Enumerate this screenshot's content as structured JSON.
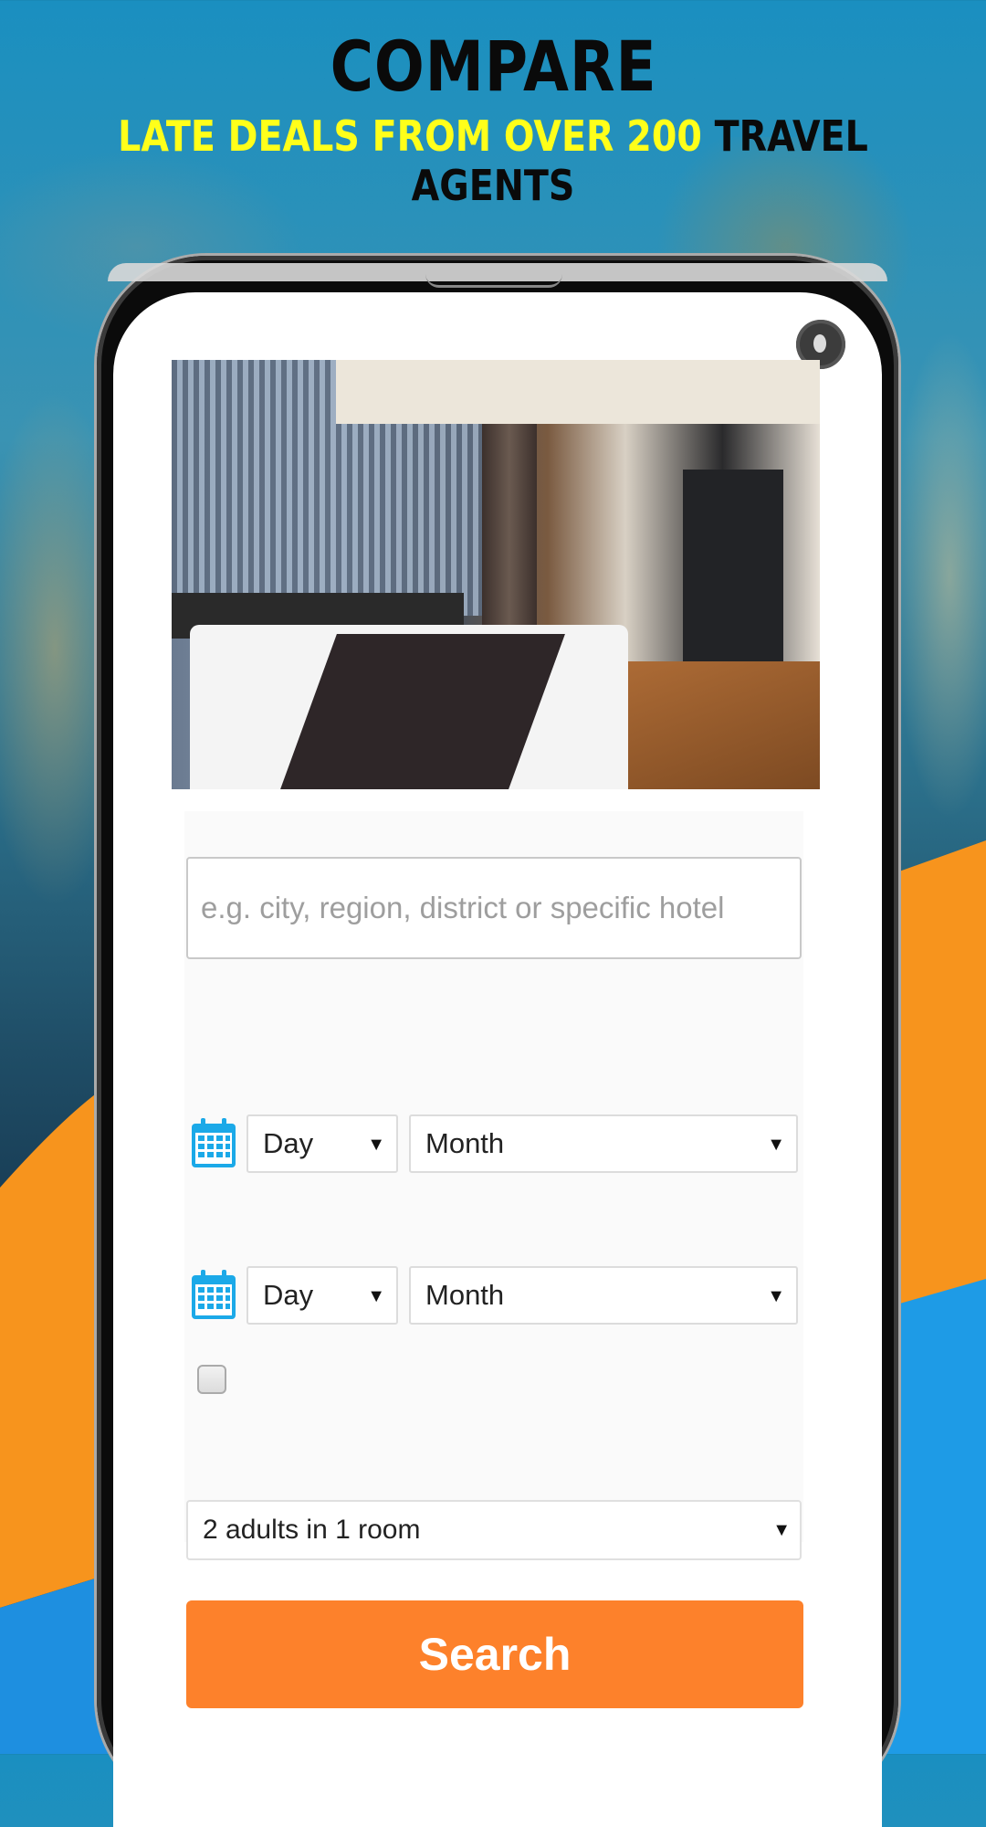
{
  "banner": {
    "headline": "COMPARE",
    "subline_highlight": "LATE DEALS FROM OVER 200",
    "subline_rest": "TRAVEL AGENTS",
    "colors": {
      "highlight": "#ffff1a",
      "dark": "#0a0a0a",
      "orange": "#f7941d",
      "blue": "#1e9be6"
    }
  },
  "form": {
    "destination": {
      "value": "",
      "placeholder": "e.g. city, region, district or specific hotel"
    },
    "checkin": {
      "day": "Day",
      "month": "Month"
    },
    "checkout": {
      "day": "Day",
      "month": "Month"
    },
    "no_dates_checkbox": {
      "checked": false
    },
    "guests": {
      "selected": "2 adults in 1 room"
    },
    "search_label": "Search",
    "colors": {
      "search_button": "#fd812b",
      "calendar_icon": "#1ba9e8"
    }
  },
  "icons": {
    "calendar": "calendar-icon",
    "dropdown": "▼",
    "camera": "front-camera-icon"
  }
}
